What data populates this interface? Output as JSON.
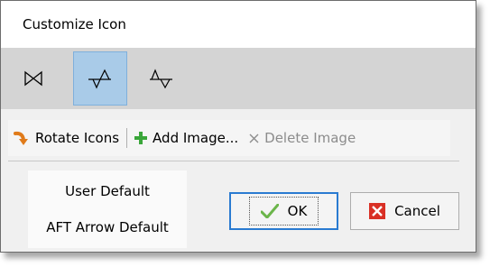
{
  "window": {
    "title": "Customize Icon"
  },
  "icon_options": [
    {
      "icon": "bowtie-icon",
      "selected": false
    },
    {
      "icon": "arrow-triangle-icon",
      "selected": true
    },
    {
      "icon": "arrow-triangle-alt-icon",
      "selected": false
    }
  ],
  "toolbar": {
    "rotate_label": "Rotate Icons",
    "add_label": "Add Image...",
    "delete_label": "Delete Image"
  },
  "defaults": {
    "items": [
      "User Default",
      "AFT Arrow Default"
    ]
  },
  "buttons": {
    "ok_label": "OK",
    "cancel_label": "Cancel"
  },
  "colors": {
    "selected_bg": "#a9cbe8",
    "ok_border": "#2a7bd1",
    "add_icon": "#3aa63a",
    "cancel_icon": "#d93025"
  }
}
